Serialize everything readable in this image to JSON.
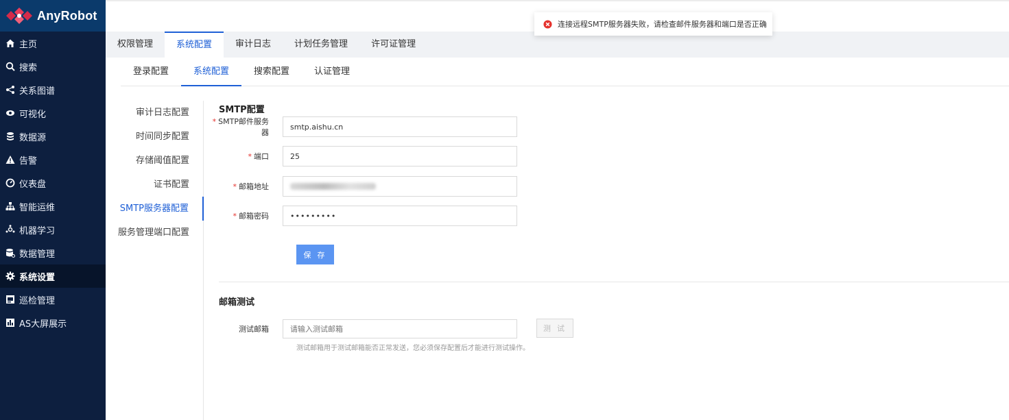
{
  "app": {
    "title": "AnyRobot"
  },
  "sidebar": {
    "items": [
      {
        "label": "主页",
        "icon": "home-icon"
      },
      {
        "label": "搜索",
        "icon": "search-icon"
      },
      {
        "label": "关系图谱",
        "icon": "graph-icon"
      },
      {
        "label": "可视化",
        "icon": "eye-icon"
      },
      {
        "label": "数据源",
        "icon": "database-icon"
      },
      {
        "label": "告警",
        "icon": "warning-icon"
      },
      {
        "label": "仪表盘",
        "icon": "gauge-icon"
      },
      {
        "label": "智能运维",
        "icon": "hierarchy-icon"
      },
      {
        "label": "机器学习",
        "icon": "ml-icon"
      },
      {
        "label": "数据管理",
        "icon": "data-manage-icon"
      },
      {
        "label": "系统设置",
        "icon": "gear-icon",
        "active": true
      },
      {
        "label": "巡检管理",
        "icon": "inspection-icon"
      },
      {
        "label": "AS大屏展示",
        "icon": "bar-chart-icon"
      }
    ]
  },
  "top_tabs": [
    "权限管理",
    "系统配置",
    "审计日志",
    "计划任务管理",
    "许可证管理"
  ],
  "top_tabs_active": "系统配置",
  "sub_tabs": [
    "登录配置",
    "系统配置",
    "搜索配置",
    "认证管理"
  ],
  "sub_tabs_active": "系统配置",
  "config_menu": [
    "审计日志配置",
    "时间同步配置",
    "存储阈值配置",
    "证书配置",
    "SMTP服务器配置",
    "服务管理端口配置"
  ],
  "config_menu_active": "SMTP服务器配置",
  "smtp": {
    "title": "SMTP配置",
    "server_label": "SMTP邮件服务器",
    "server_value": "smtp.aishu.cn",
    "port_label": "端口",
    "port_value": "25",
    "email_label": "邮箱地址",
    "password_label": "邮箱密码",
    "password_value": "•••••••••",
    "save_label": "保 存"
  },
  "mail_test": {
    "title": "邮箱测试",
    "label": "测试邮箱",
    "placeholder": "请输入测试邮箱",
    "button_label": "测 试",
    "hint": "测试邮箱用于测试邮箱能否正常发送，您必须保存配置后才能进行测试操作。"
  },
  "toast": {
    "message": "连接远程SMTP服务器失败，请检查邮件服务器和端口是否正确"
  },
  "colors": {
    "accent": "#1e5fd6",
    "sidebar": "#0d1f3f",
    "error": "#e5322d"
  }
}
